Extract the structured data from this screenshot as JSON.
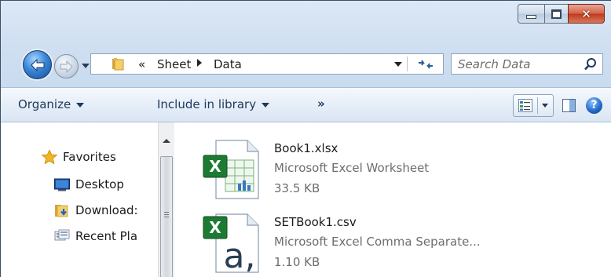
{
  "window": {
    "caption_buttons": {
      "minimize": "minimize",
      "maximize": "maximize",
      "close": "close"
    },
    "close_color": "#c8462a"
  },
  "address": {
    "overflow_marker": "«",
    "crumbs": [
      "Sheet",
      "Data"
    ]
  },
  "search": {
    "placeholder": "Search Data"
  },
  "toolbar": {
    "organize_label": "Organize",
    "include_label": "Include in library",
    "more_label": "»",
    "help_label": "?"
  },
  "nav": {
    "items": [
      {
        "label": "Favorites",
        "icon": "star-icon"
      },
      {
        "label": "Desktop",
        "icon": "desktop-icon"
      },
      {
        "label": "Download:",
        "icon": "downloads-folder-icon"
      },
      {
        "label": "Recent Pla",
        "icon": "recent-places-icon"
      }
    ]
  },
  "files": [
    {
      "name": "Book1.xlsx",
      "type": "Microsoft Excel Worksheet",
      "size": "33.5 KB",
      "icon": "excel-worksheet-icon"
    },
    {
      "name": "SETBook1.csv",
      "type": "Microsoft Excel Comma Separate...",
      "size": "1.10 KB",
      "icon": "excel-csv-icon"
    }
  ],
  "colors": {
    "accent": "#1e395b",
    "excel_green": "#1d7a33",
    "window_bg": "#cfdff1"
  }
}
